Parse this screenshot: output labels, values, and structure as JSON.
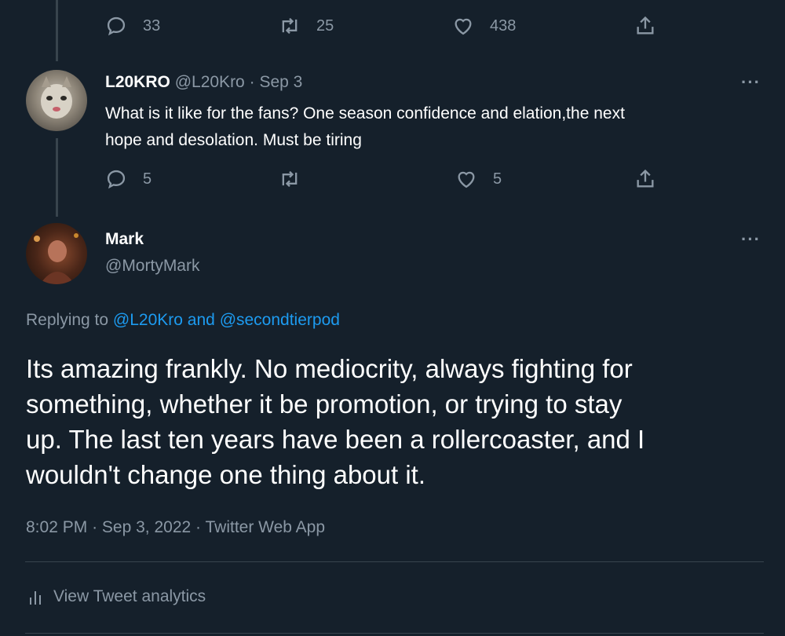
{
  "top_actions": {
    "reply_count": "33",
    "retweet_count": "25",
    "like_count": "438"
  },
  "reply_tweet": {
    "display_name": "L20KRO",
    "handle": "@L20Kro",
    "separator": "·",
    "date": "Sep 3",
    "text_line1": "What is it like for the fans? One season confidence and elation,the next",
    "text_line2": "hope and desolation. Must be tiring",
    "reply_count": "5",
    "retweet_count": "",
    "like_count": "5"
  },
  "main_tweet": {
    "display_name": "Mark",
    "handle": "@MortyMark",
    "replying_to_prefix": "Replying to",
    "replying_to_user1": "@L20Kro",
    "replying_to_and": "and",
    "replying_to_user2": "@secondtierpod",
    "text_line1": "Its amazing frankly. No mediocrity, always fighting for",
    "text_line2": "something, whether it be promotion, or trying to stay",
    "text_line3": "up. The last ten years have been a rollercoaster, and I",
    "text_line4": "wouldn't change one thing about it.",
    "time": "8:02 PM",
    "separator": "·",
    "date": "Sep 3, 2022",
    "source": "Twitter Web App",
    "analytics_label": "View Tweet analytics"
  },
  "more_icon": "···",
  "colors": {
    "background": "#15202b",
    "text": "#ffffff",
    "muted": "#8b98a5",
    "link": "#1d9bf0",
    "divider": "#38444d"
  }
}
